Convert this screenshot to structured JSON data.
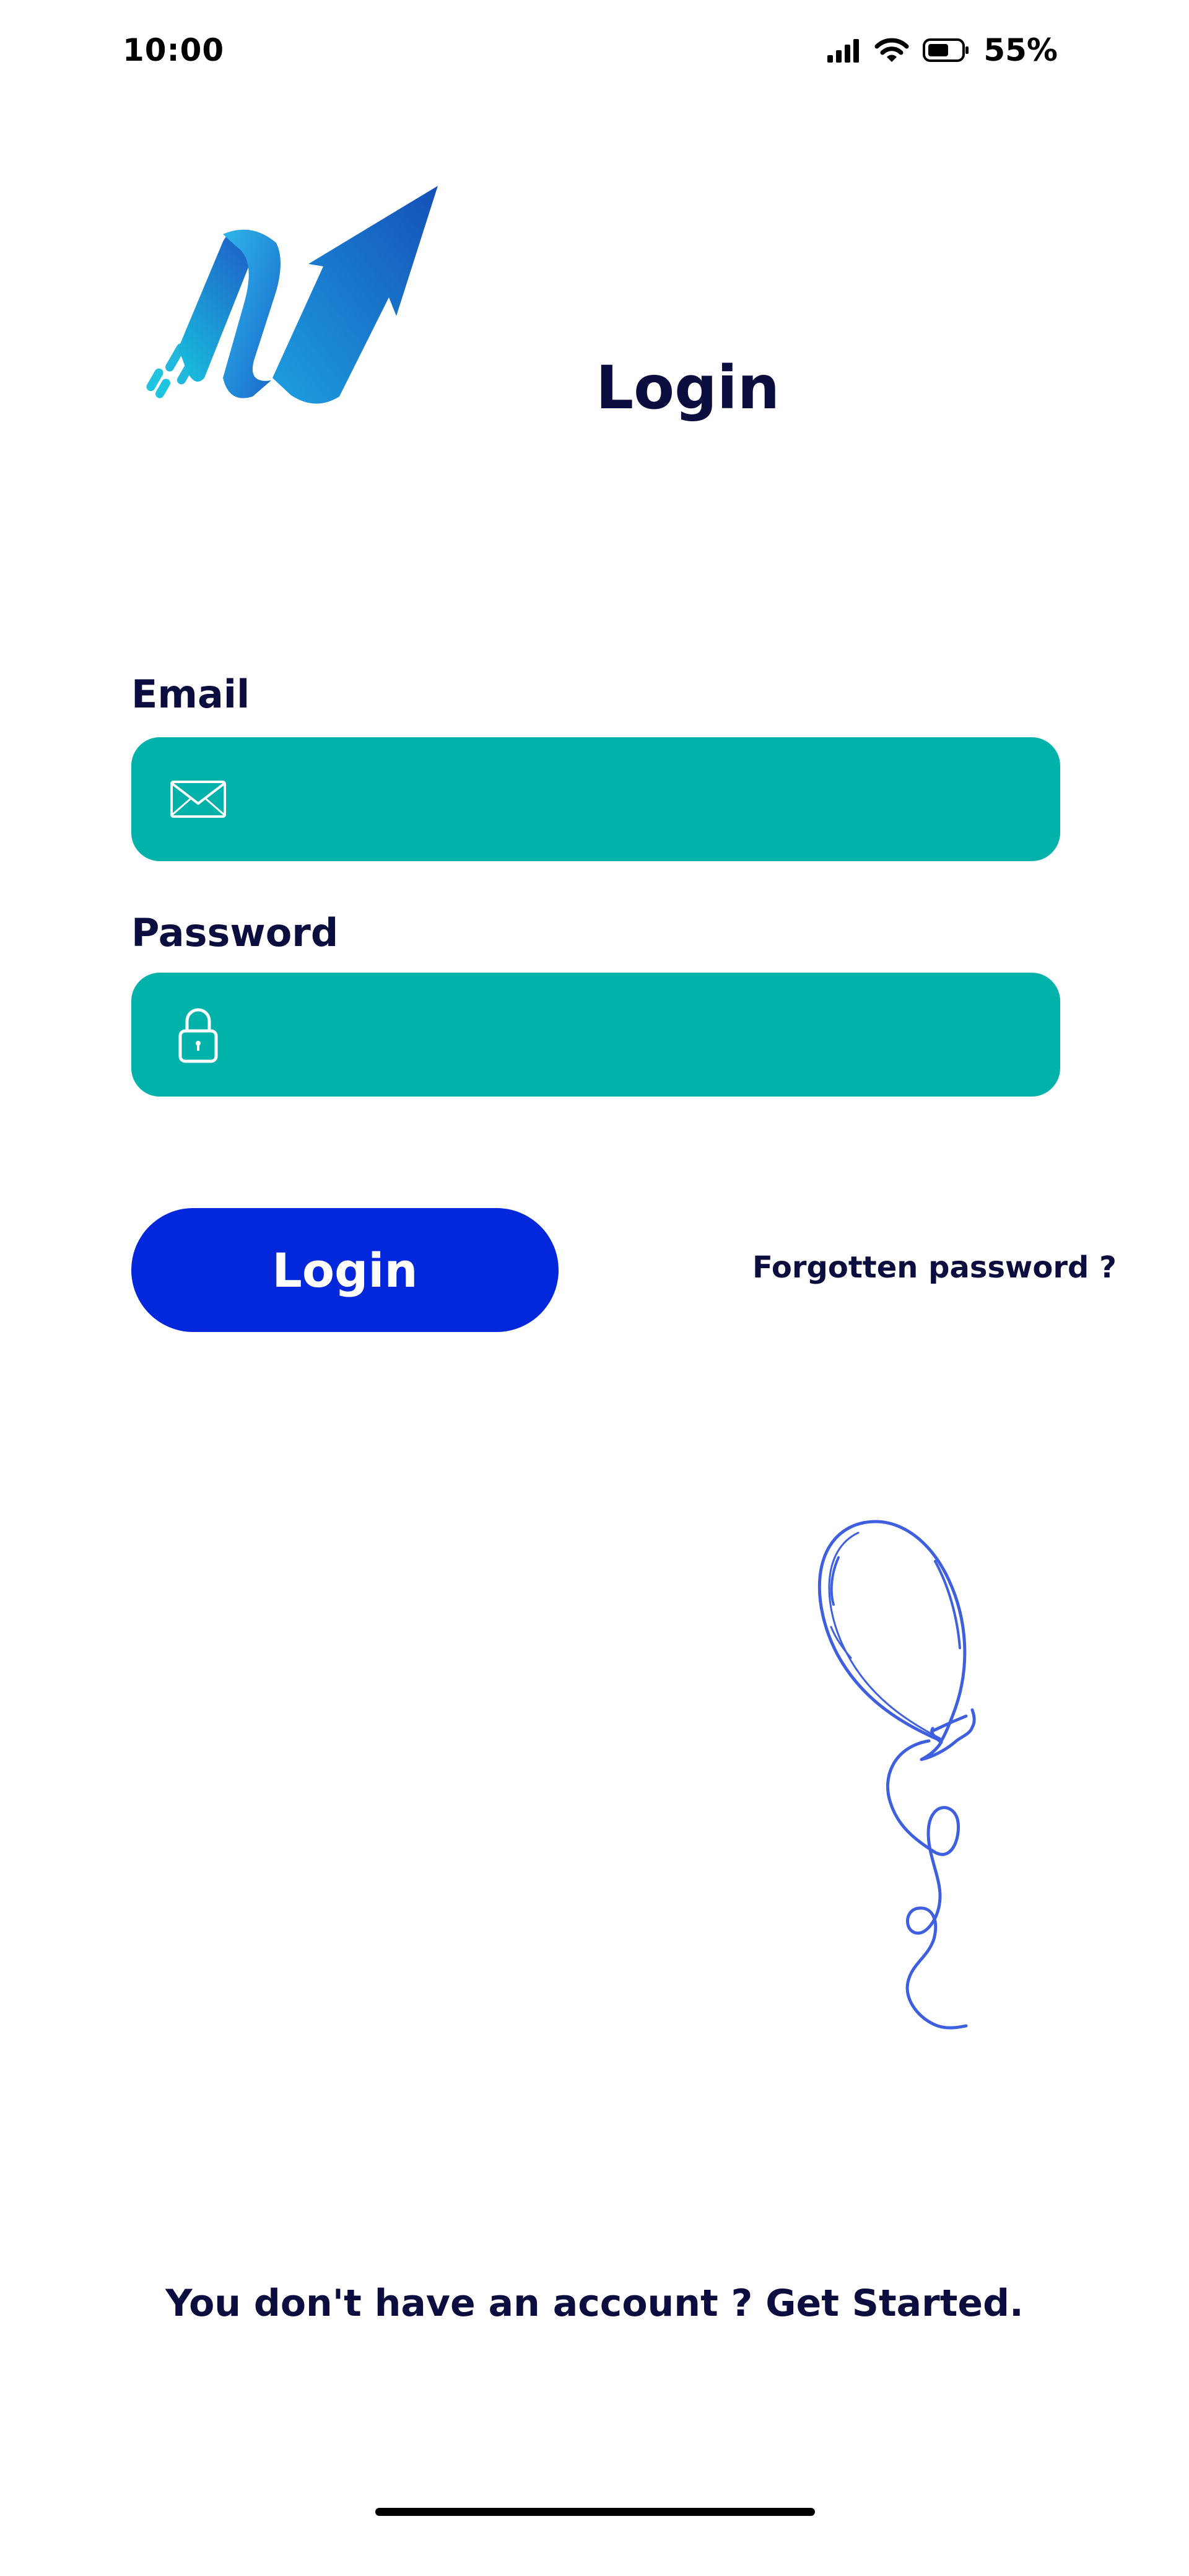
{
  "status_bar": {
    "time": "10:00",
    "battery_percent": "55%",
    "icons": [
      "signal-icon",
      "wifi-icon",
      "battery-icon"
    ]
  },
  "header": {
    "logo": "brand-logo",
    "title": "Login"
  },
  "form": {
    "email_label": "Email",
    "email_value": "",
    "email_icon": "envelope-icon",
    "password_label": "Password",
    "password_value": "",
    "password_icon": "lock-icon",
    "login_button": "Login",
    "forgot_link": "Forgotten password ?"
  },
  "illustration": "balloon-illustration",
  "footer": {
    "prompt": "You don't have an account ? ",
    "cta": "Get Started."
  },
  "colors": {
    "field_bg": "#00b2aa",
    "primary_button": "#0328dc",
    "text_dark": "#0b0d3f",
    "balloon_stroke": "#3e5fe0"
  }
}
